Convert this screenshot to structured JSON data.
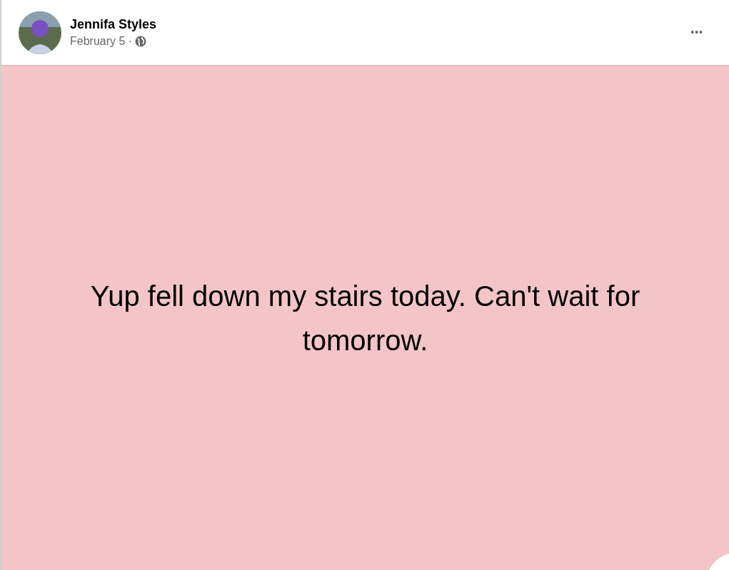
{
  "post": {
    "author": "Jennifa Styles",
    "date": "February 5",
    "separator": "·",
    "more": "•••",
    "text": "Yup fell down my stairs today. Can't wait for tomorrow."
  }
}
